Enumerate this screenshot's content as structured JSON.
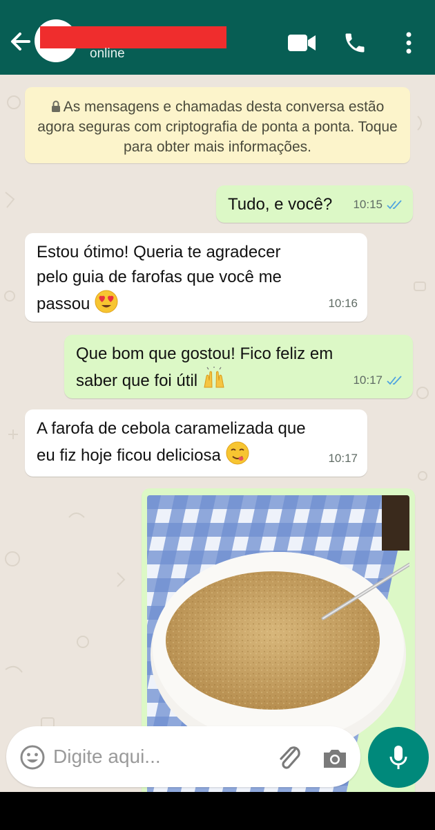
{
  "header": {
    "contact_name": "",
    "status": "online"
  },
  "encryption_notice": "As mensagens e chamadas desta conversa estão agora seguras com criptografia de ponta a ponta. Toque para obter mais informações.",
  "messages": [
    {
      "direction": "out",
      "lines": [
        "Tudo, e você?"
      ],
      "time": "10:15",
      "ticks": "read"
    },
    {
      "direction": "in",
      "lines": [
        "Estou ótimo! Queria te agradecer",
        "pelo guia de farofas que você me",
        "passou"
      ],
      "emoji": "heart-eyes-emoji",
      "time": "10:16"
    },
    {
      "direction": "out",
      "lines": [
        "Que bom que gostou! Fico feliz em",
        "saber que foi útil"
      ],
      "emoji": "raising-hands-emoji",
      "time": "10:17",
      "ticks": "read"
    },
    {
      "direction": "in",
      "lines": [
        "A farofa de cebola caramelizada que",
        "eu fiz hoje ficou deliciosa"
      ],
      "emoji": "yum-emoji",
      "time": "10:17"
    },
    {
      "direction": "out",
      "type": "image",
      "subject": "bowl-of-farofa-photo"
    }
  ],
  "composer": {
    "placeholder": "Digite aqui..."
  },
  "colors": {
    "header": "#075e54",
    "outgoing_bubble": "#dcf8c6",
    "incoming_bubble": "#ffffff",
    "chat_background": "#ece5dd",
    "notice_background": "#fcf4cb",
    "mic_button": "#00897b",
    "read_ticks": "#4fa3e0"
  }
}
